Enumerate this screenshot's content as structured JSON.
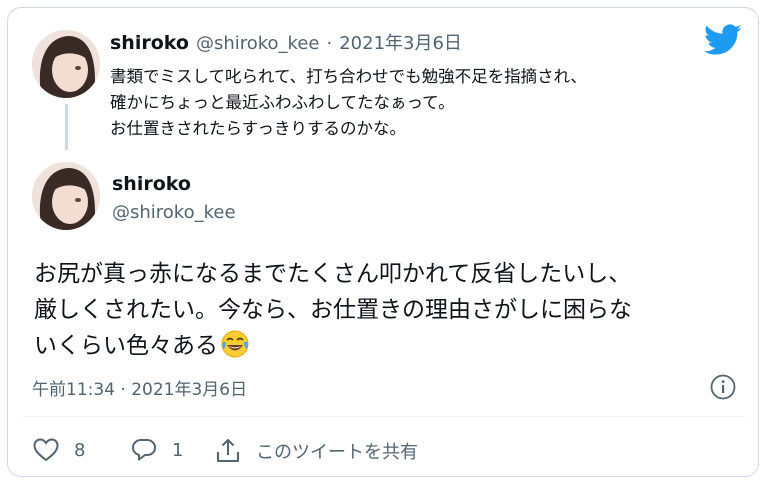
{
  "reply_tweet": {
    "display_name": "shiroko",
    "handle": "@shiroko_kee",
    "separator": "·",
    "date": "2021年3月6日",
    "text": "書類でミスして叱られて、打ち合わせでも勉強不足を指摘され、\n確かにちょっと最近ふわふわしてたなぁって。\nお仕置きされたらすっきりするのかな。"
  },
  "main_tweet": {
    "display_name": "shiroko",
    "handle": "@shiroko_kee",
    "text": "お尻が真っ赤になるまでたくさん叩かれて反省したいし、\n厳しくされたい。今なら、お仕置きの理由さがしに困らな\nいくらい色々ある",
    "emoji": "face-with-tears-of-joy",
    "timestamp": "午前11:34 · 2021年3月6日"
  },
  "actions": {
    "like_count": "8",
    "reply_count": "1",
    "share_label": "このツイートを共有"
  },
  "colors": {
    "twitter_blue": "#1d9bf0",
    "muted": "#536471",
    "border": "#cfd9de"
  },
  "icons": [
    "twitter-bird-icon",
    "info-icon",
    "heart-icon",
    "reply-bubble-icon",
    "share-icon"
  ]
}
